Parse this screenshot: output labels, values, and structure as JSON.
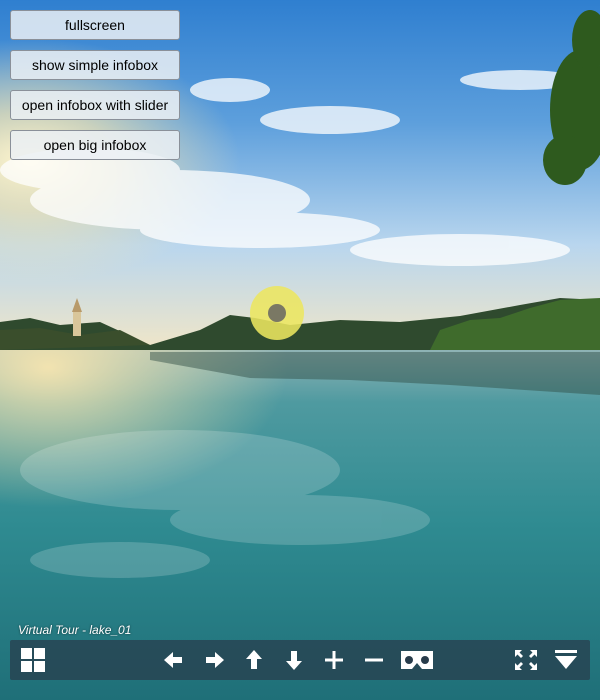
{
  "side_buttons": {
    "fullscreen_label": "fullscreen",
    "simple_infobox_label": "show simple infobox",
    "infobox_slider_label": "open infobox with slider",
    "big_infobox_label": "open big infobox"
  },
  "tour": {
    "title": "Virtual Tour - lake_01"
  },
  "hotspot": {
    "color": "#ece660",
    "core_color": "#7a7864"
  },
  "control_bar": {
    "background": "#283c4b",
    "icons": [
      "thumbnails-icon",
      "arrow-left-icon",
      "arrow-right-icon",
      "arrow-up-icon",
      "arrow-down-icon",
      "zoom-in-icon",
      "zoom-out-icon",
      "vr-goggles-icon",
      "fullscreen-icon",
      "hide-controls-icon"
    ]
  }
}
